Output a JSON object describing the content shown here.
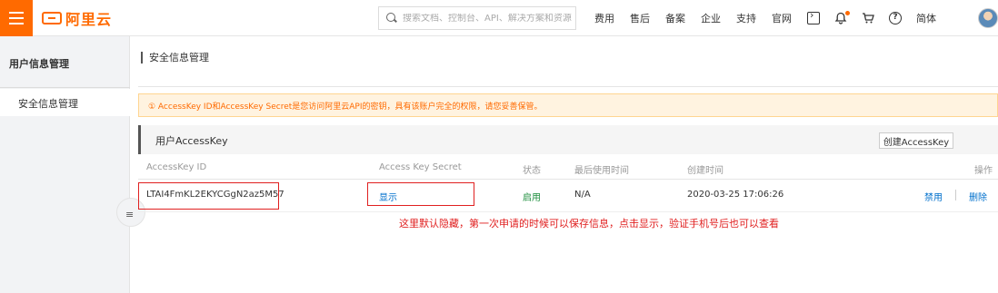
{
  "header": {
    "logo_text": "阿里云",
    "search_placeholder": "搜索文档、控制台、API、解决方案和资源",
    "nav_items": [
      "费用",
      "售后",
      "备案",
      "企业",
      "支持",
      "官网"
    ],
    "lang": "简体",
    "icons": [
      "terminal-icon",
      "bell-icon",
      "cart-icon",
      "help-icon"
    ],
    "brand_color": "#ff6a00"
  },
  "sidebar": {
    "title": "用户信息管理",
    "items": [
      {
        "label": "安全信息管理",
        "active": true
      }
    ],
    "collapse_icon": "≡"
  },
  "main": {
    "page_title": "安全信息管理",
    "notice": "① AccessKey ID和AccessKey Secret是您访问阿里云API的密钥，具有该账户完全的权限，请您妥善保管。",
    "panel_title": "用户AccessKey",
    "create_button": "创建AccessKey",
    "table": {
      "columns": [
        "AccessKey ID",
        "Access Key Secret",
        "状态",
        "最后使用时间",
        "创建时间",
        "操作"
      ],
      "rows": [
        {
          "access_key_id": "LTAI4FmKL2EKYCGgN2az5M57",
          "secret_action": "显示",
          "status": "启用",
          "last_used": "N/A",
          "created": "2020-03-25 17:06:26",
          "actions": [
            "禁用",
            "删除"
          ]
        }
      ]
    },
    "annotation": "这里默认隐藏，第一次申请的时候可以保存信息，点击显示，验证手机号后也可以查看"
  }
}
